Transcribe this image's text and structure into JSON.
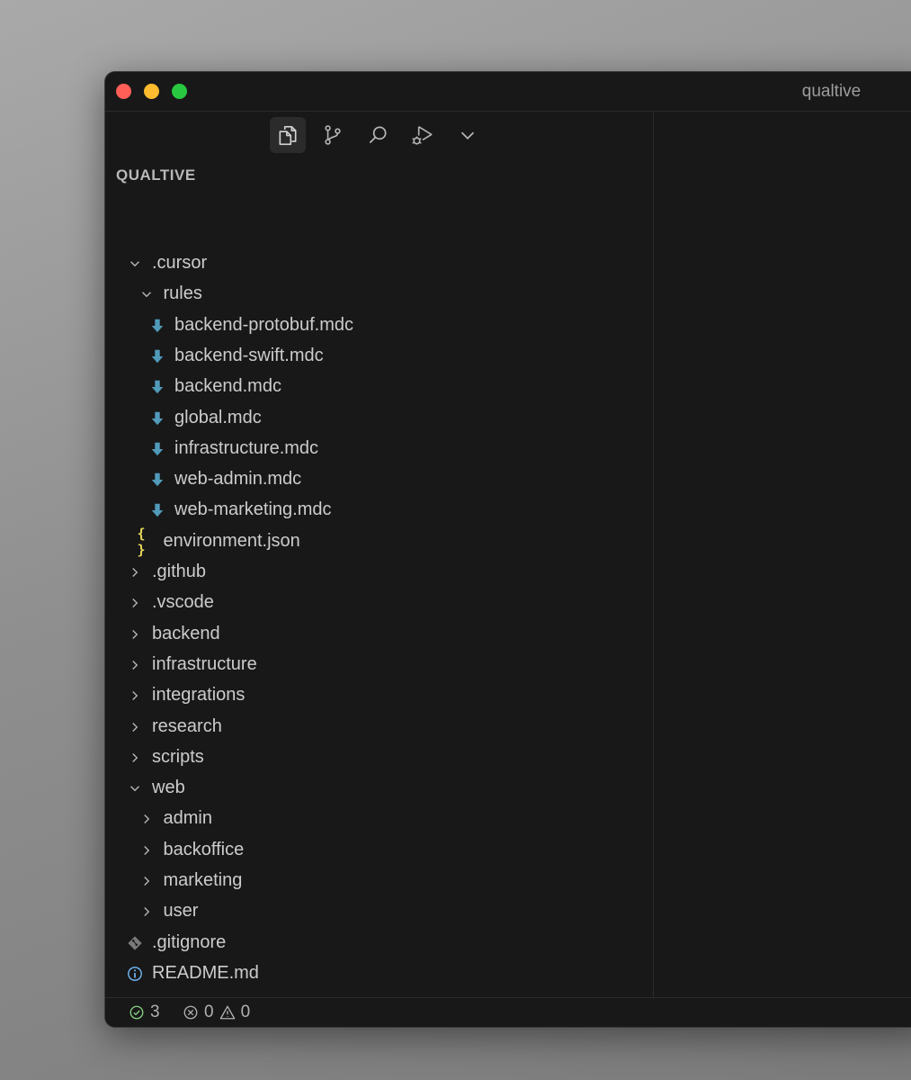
{
  "window": {
    "title": "qualtive"
  },
  "toolbar": {
    "items": [
      {
        "name": "explorer-icon",
        "active": true
      },
      {
        "name": "source-control-icon",
        "active": false
      },
      {
        "name": "search-icon",
        "active": false
      },
      {
        "name": "run-debug-icon",
        "active": false
      },
      {
        "name": "chevron-down-icon",
        "active": false
      }
    ]
  },
  "explorer": {
    "section_title": "QUALTIVE",
    "tree": [
      {
        "label": ".cursor",
        "type": "folder",
        "expanded": true,
        "depth": 0
      },
      {
        "label": "rules",
        "type": "folder",
        "expanded": true,
        "depth": 1
      },
      {
        "label": "backend-protobuf.mdc",
        "type": "file",
        "icon": "download-arrow-icon",
        "depth": 2
      },
      {
        "label": "backend-swift.mdc",
        "type": "file",
        "icon": "download-arrow-icon",
        "depth": 2
      },
      {
        "label": "backend.mdc",
        "type": "file",
        "icon": "download-arrow-icon",
        "depth": 2
      },
      {
        "label": "global.mdc",
        "type": "file",
        "icon": "download-arrow-icon",
        "depth": 2
      },
      {
        "label": "infrastructure.mdc",
        "type": "file",
        "icon": "download-arrow-icon",
        "depth": 2
      },
      {
        "label": "web-admin.mdc",
        "type": "file",
        "icon": "download-arrow-icon",
        "depth": 2
      },
      {
        "label": "web-marketing.mdc",
        "type": "file",
        "icon": "download-arrow-icon",
        "depth": 2
      },
      {
        "label": "environment.json",
        "type": "file",
        "icon": "json-braces-icon",
        "depth": 1
      },
      {
        "label": ".github",
        "type": "folder",
        "expanded": false,
        "depth": 0
      },
      {
        "label": ".vscode",
        "type": "folder",
        "expanded": false,
        "depth": 0
      },
      {
        "label": "backend",
        "type": "folder",
        "expanded": false,
        "depth": 0
      },
      {
        "label": "infrastructure",
        "type": "folder",
        "expanded": false,
        "depth": 0
      },
      {
        "label": "integrations",
        "type": "folder",
        "expanded": false,
        "depth": 0
      },
      {
        "label": "research",
        "type": "folder",
        "expanded": false,
        "depth": 0
      },
      {
        "label": "scripts",
        "type": "folder",
        "expanded": false,
        "depth": 0
      },
      {
        "label": "web",
        "type": "folder",
        "expanded": true,
        "depth": 0
      },
      {
        "label": "admin",
        "type": "folder",
        "expanded": false,
        "depth": 1
      },
      {
        "label": "backoffice",
        "type": "folder",
        "expanded": false,
        "depth": 1
      },
      {
        "label": "marketing",
        "type": "folder",
        "expanded": false,
        "depth": 1
      },
      {
        "label": "user",
        "type": "folder",
        "expanded": false,
        "depth": 1
      },
      {
        "label": ".gitignore",
        "type": "file",
        "icon": "git-diamond-icon",
        "depth": 0
      },
      {
        "label": "README.md",
        "type": "file",
        "icon": "info-icon",
        "depth": 0
      }
    ]
  },
  "statusbar": {
    "checks": "3",
    "errors": "0",
    "warnings": "0"
  },
  "colors": {
    "background": "#181818",
    "text": "#cccccc",
    "mdc_icon": "#519aba",
    "json_icon": "#e6d85a",
    "info_icon": "#75beff",
    "check_icon": "#89d185"
  }
}
